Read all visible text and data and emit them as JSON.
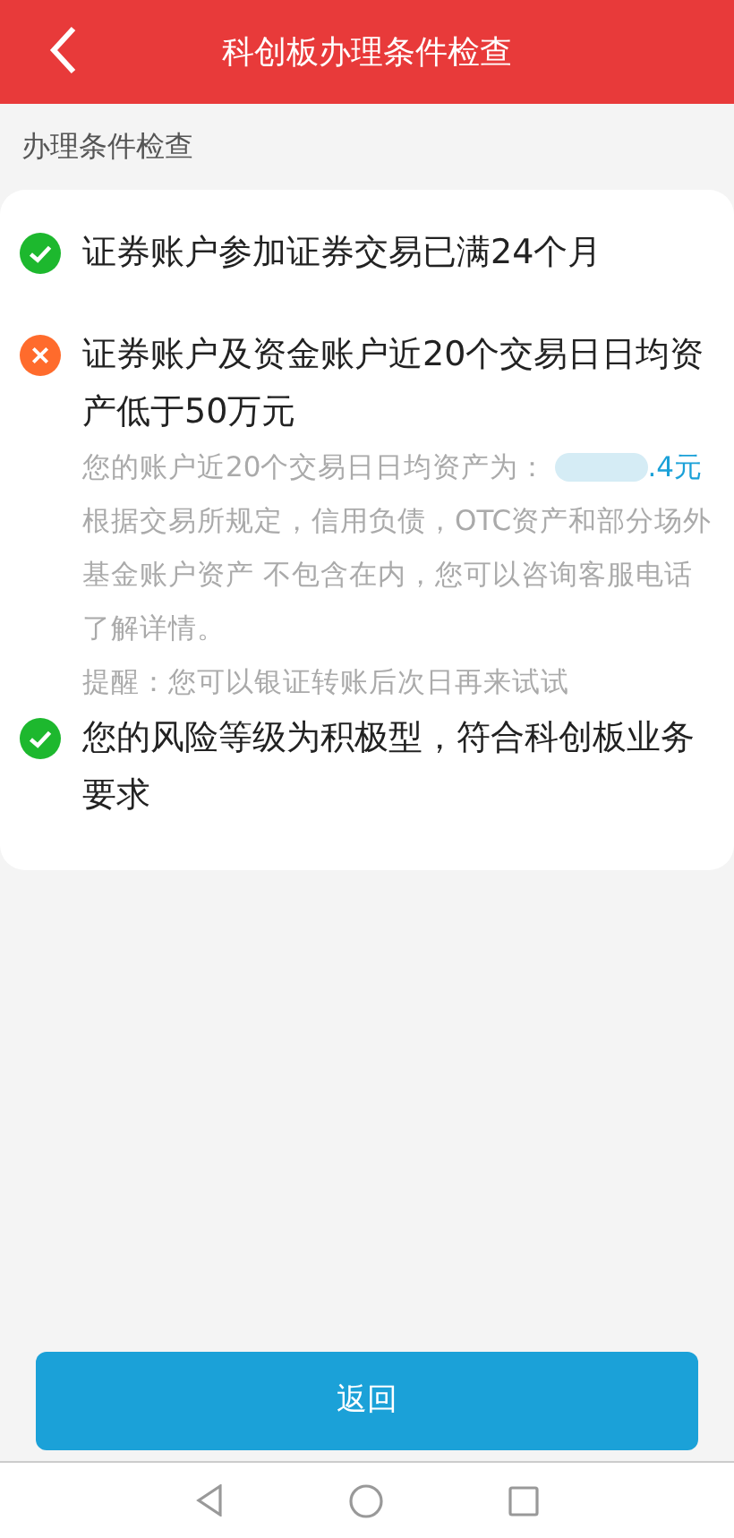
{
  "header": {
    "title": "科创板办理条件检查"
  },
  "section_label": "办理条件检查",
  "conditions": [
    {
      "kind": "pass",
      "text": "证券账户参加证券交易已满24个月"
    },
    {
      "kind": "fail",
      "text": "证券账户及资金账户近20个交易日日均资产低于50万元",
      "details": [
        {
          "kind": "amount",
          "label": "您的账户近20个交易日日均资产为：",
          "value": ".4元"
        },
        {
          "kind": "note",
          "text": "根据交易所规定，信用负债，OTC资产和部分场外基金账户资产 不包含在内，您可以咨询客服电话了解详情。"
        },
        {
          "kind": "note",
          "text": "提醒：您可以银证转账后次日再来试试"
        }
      ]
    },
    {
      "kind": "pass",
      "text": "您的风险等级为积极型，符合科创板业务要求"
    }
  ],
  "button": "返回"
}
